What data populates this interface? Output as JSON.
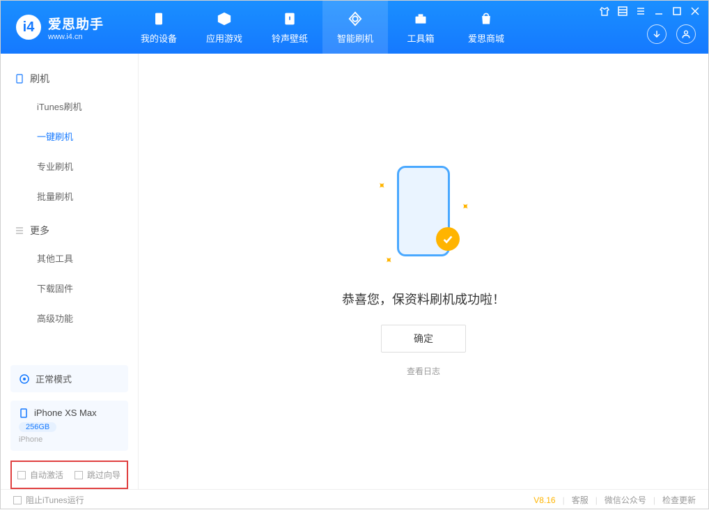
{
  "brand": {
    "name": "爱思助手",
    "site": "www.i4.cn"
  },
  "nav": [
    {
      "label": "我的设备"
    },
    {
      "label": "应用游戏"
    },
    {
      "label": "铃声壁纸"
    },
    {
      "label": "智能刷机"
    },
    {
      "label": "工具箱"
    },
    {
      "label": "爱思商城"
    }
  ],
  "sidebar": {
    "section1_title": "刷机",
    "section1_items": [
      "iTunes刷机",
      "一键刷机",
      "专业刷机",
      "批量刷机"
    ],
    "section2_title": "更多",
    "section2_items": [
      "其他工具",
      "下载固件",
      "高级功能"
    ]
  },
  "device": {
    "mode": "正常模式",
    "name": "iPhone XS Max",
    "storage": "256GB",
    "type": "iPhone"
  },
  "options": {
    "auto_activate": "自动激活",
    "skip_guide": "跳过向导"
  },
  "main": {
    "success_message": "恭喜您，保资料刷机成功啦！",
    "ok_button": "确定",
    "view_log": "查看日志"
  },
  "footer": {
    "block_itunes": "阻止iTunes运行",
    "version": "V8.16",
    "links": [
      "客服",
      "微信公众号",
      "检查更新"
    ]
  }
}
